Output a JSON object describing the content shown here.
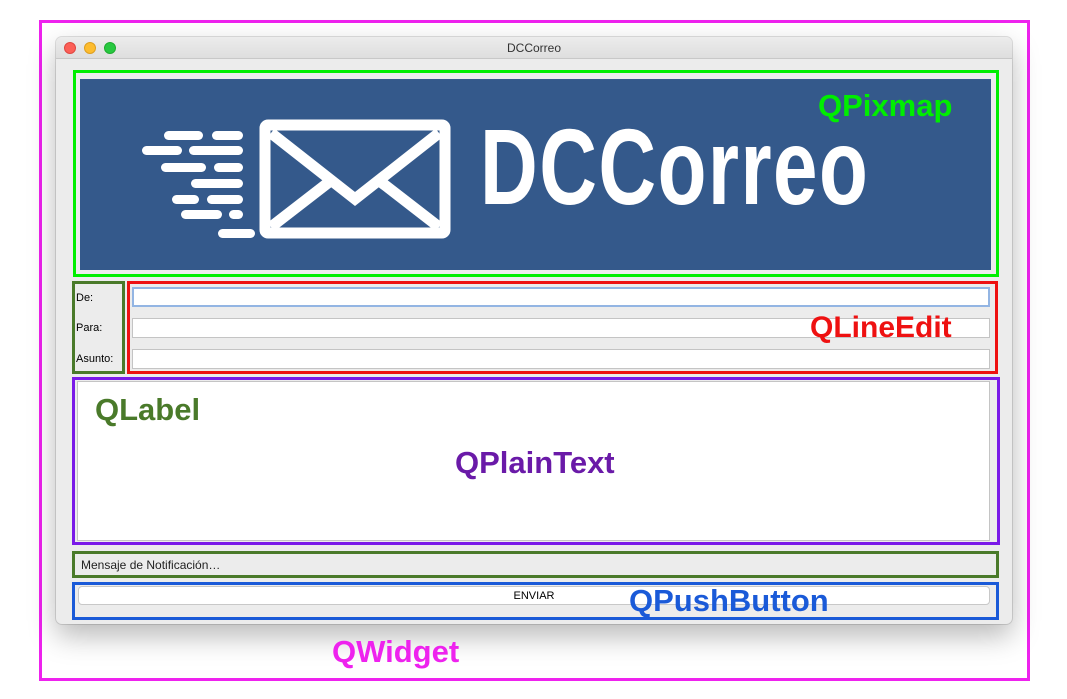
{
  "window": {
    "title": "DCCorreo"
  },
  "banner": {
    "logo_text": "DCCorreo",
    "background": "#34598b",
    "icon": "envelope-icon"
  },
  "form": {
    "from_label": "De:",
    "to_label": "Para:",
    "subject_label": "Asunto:",
    "from_value": "",
    "to_value": "",
    "subject_value": ""
  },
  "body_text": "",
  "notification": "Mensaje de Notificación…",
  "send_button": "ENVIAR",
  "annotations": {
    "qpixmap": {
      "text": "QPixmap",
      "color": "#00ee00"
    },
    "qlineedit": {
      "text": "QLineEdit",
      "color": "#ee1111"
    },
    "qlabel": {
      "text": "QLabel",
      "color": "#4a7a2a"
    },
    "qplaintext": {
      "text": "QPlainText",
      "color": "#6a1aa8"
    },
    "qpushbutton": {
      "text": "QPushButton",
      "color": "#1a5ad8"
    },
    "qwidget": {
      "text": "QWidget",
      "color": "#ee22ee"
    }
  }
}
